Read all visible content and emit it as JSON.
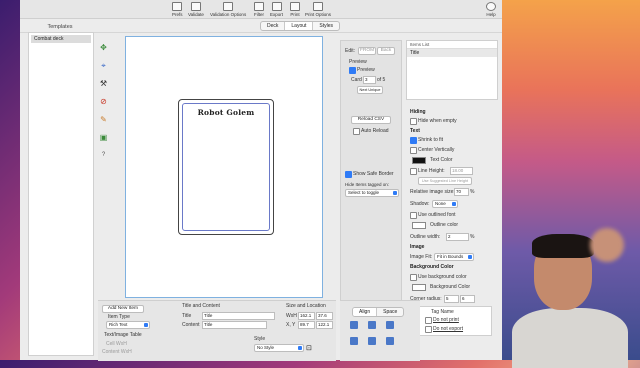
{
  "toolbar": {
    "prefs": "Prefs",
    "validate": "Validate",
    "validation_options": "Validation Options",
    "filter": "Filter",
    "export": "Export",
    "print": "Print",
    "print_options": "Print Options",
    "help": "Help"
  },
  "view_tabs": [
    "Deck",
    "Layout",
    "Styles"
  ],
  "templates": {
    "heading": "Templates",
    "items": [
      "Combat deck"
    ]
  },
  "card": {
    "title": "Robot Golem"
  },
  "edit": {
    "label": "Edit:",
    "from": "FROM",
    "back": "Back",
    "preview_heading": "Preview",
    "preview_label": "Preview",
    "card_label": "Card",
    "card_value": "3",
    "card_of": "of 5",
    "next_unique": "Next Unique",
    "reload_csv": "Reload CSV",
    "auto_reload": "Auto Reload",
    "show_safe_border": "Show Safe Border",
    "hide_items_label": "Hide Items tagged on:",
    "hide_items_select": "Select to toggle"
  },
  "items_list": {
    "heading": "Items List",
    "items": [
      "Title"
    ]
  },
  "props": {
    "hiding": "Hiding",
    "hide_when_empty": "Hide when empty",
    "text": "Text",
    "shrink_to_fit": "Shrink to fit",
    "center_vertically": "Center Vertically",
    "text_color": "Text Color",
    "line_height": "Line Height:",
    "line_height_value": "18.00",
    "use_suggested": "Use Suggested Line Height",
    "relative_size_label": "Relative image size:",
    "relative_size_value": "70",
    "percent": "%",
    "shadow_label": "Shadow:",
    "shadow_value": "None",
    "use_outlined_font": "Use outlined font",
    "outline_color": "Outline color",
    "outline_width_label": "Outline width:",
    "outline_width_value": "2",
    "image": "Image",
    "image_fit_label": "Image Fit:",
    "image_fit_value": "Fit in Bounds",
    "use_bg_color": "Use background color",
    "bg_color_label": "Background Color",
    "bg_color_section": "Background Color",
    "corner_radius_label": "Corner radius:",
    "corner_radius_value": "5",
    "corner_radius_value2": "6",
    "tag_name": "Tag Name",
    "tag1": "Do not print",
    "tag2": "Do not export"
  },
  "bottom": {
    "add_new_item": "Add New Item",
    "item_type_label": "Item Type",
    "item_type_value": "Rich Text",
    "text_image_table": "Text/Image Table",
    "cell_wxh": "Cell WxH",
    "content_wxh": "Content WxH",
    "title_and_content": "Title and Content",
    "title_label": "Title",
    "title_value": "Title",
    "content_label": "Content",
    "content_value": "Title",
    "size_location": "Size and Location",
    "wxh_label": "WxH",
    "w_value": "162.1",
    "h_value": "37.6",
    "xy_label": "X, Y",
    "x_value": "89.7",
    "y_value": "122.1",
    "style_label": "Style",
    "style_value": "No Style",
    "align_tab": "Align",
    "space_tab": "Space"
  }
}
